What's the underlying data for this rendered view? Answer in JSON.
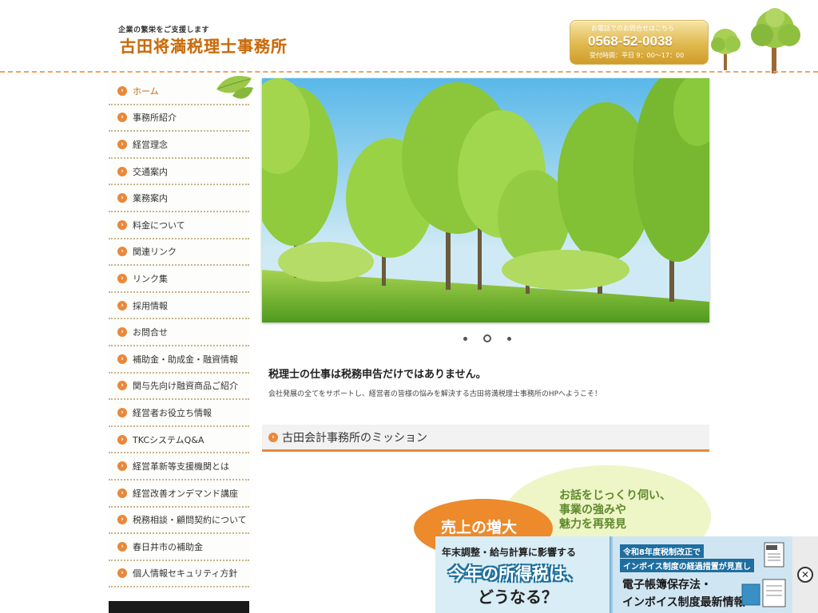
{
  "header": {
    "tagline": "企業の繁栄をご支援します",
    "site_title": "古田将満税理士事務所",
    "phone": {
      "sub": "お電話でのお問合せはこちら",
      "number": "0568-52-0038",
      "hours": "受付時間：平日 9：00～17：00"
    }
  },
  "sidebar": {
    "items": [
      {
        "label": "ホーム",
        "active": true
      },
      {
        "label": "事務所紹介"
      },
      {
        "label": "経営理念"
      },
      {
        "label": "交通案内"
      },
      {
        "label": "業務案内"
      },
      {
        "label": "料金について"
      },
      {
        "label": "関連リンク"
      },
      {
        "label": "リンク集"
      },
      {
        "label": "採用情報"
      },
      {
        "label": "お問合せ"
      },
      {
        "label": "補助金・助成金・融資情報"
      },
      {
        "label": "関与先向け融資商品ご紹介"
      },
      {
        "label": "経営者お役立ち情報"
      },
      {
        "label": "TKCシステムQ&A"
      },
      {
        "label": "経営革新等支援機関とは"
      },
      {
        "label": "経営改善オンデマンド講座"
      },
      {
        "label": "税務相談・顧問契約について"
      },
      {
        "label": "春日井市の補助金"
      },
      {
        "label": "個人情報セキュリティ方針"
      }
    ]
  },
  "slideshow": {
    "slide_count": 3,
    "active_index": 1
  },
  "intro": {
    "heading": "税理士の仕事は税務申告だけではありません。",
    "text": "会社発展の全てをサポートし、経営者の皆様の悩みを解決する古田将満税理士事務所のHPへようこそ！"
  },
  "mission": {
    "title": "古田会計事務所のミッション",
    "bubble_green": [
      "お話をじっくり伺い、",
      "事業の強みや",
      "魅力を再発見"
    ],
    "bubble_orange": "売上の増大"
  },
  "ad": {
    "left_line1": "年末調整・給与計算に影響する",
    "left_line2": "今年の所得税は、",
    "left_line3": "どうなる？",
    "right_tag1": "令和8年度税制改正で",
    "right_tag2": "インボイス制度の経過措置が見直し",
    "right_line1": "電子帳簿保存法・",
    "right_line2": "インボイス制度最新情報",
    "close_symbol": "✕"
  },
  "colors": {
    "accent": "#e9883a",
    "title": "#c86a10",
    "dash": "#e8a56a"
  }
}
